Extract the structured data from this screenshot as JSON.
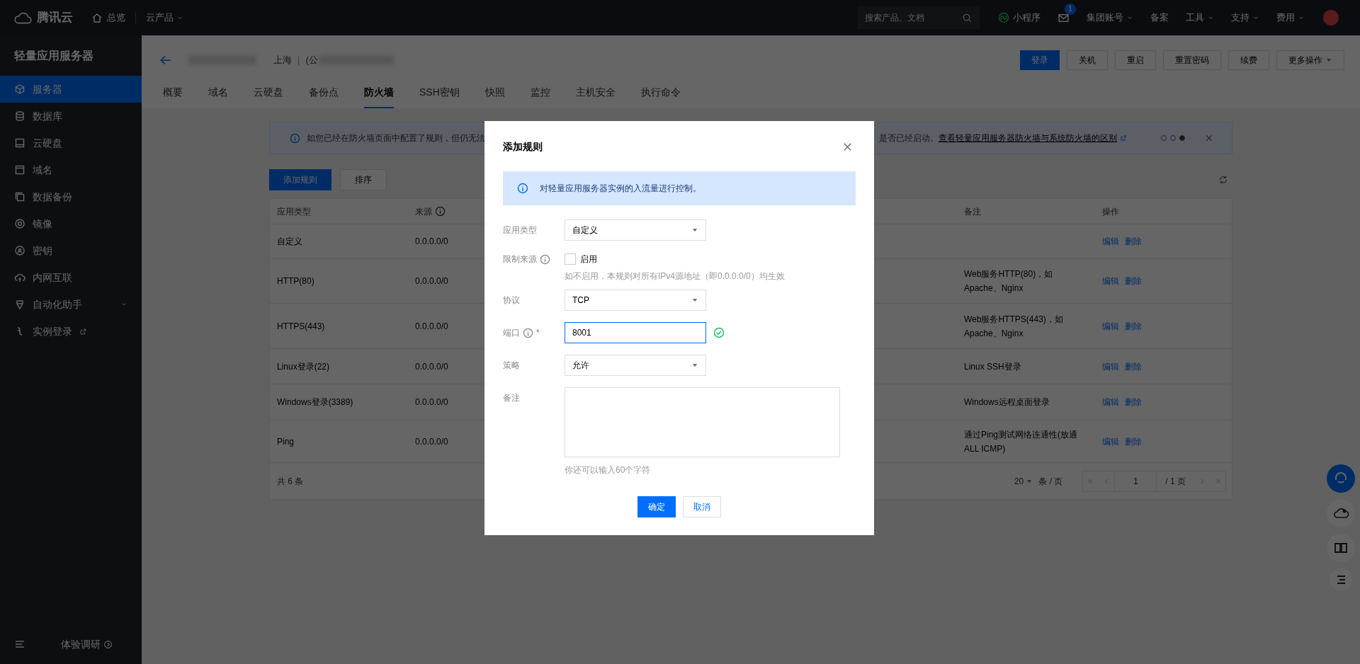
{
  "topbar": {
    "brand": "腾讯云",
    "overview": "总览",
    "products": "云产品",
    "search_placeholder": "搜索产品、文档",
    "items": [
      {
        "kind": "mini",
        "label": "小程序"
      },
      {
        "kind": "mail",
        "badge": "1"
      },
      {
        "kind": "dropdown",
        "label": "集团账号"
      },
      {
        "kind": "link",
        "label": "备案"
      },
      {
        "kind": "dropdown",
        "label": "工具"
      },
      {
        "kind": "dropdown",
        "label": "支持"
      },
      {
        "kind": "dropdown",
        "label": "费用"
      }
    ]
  },
  "sidebar": {
    "title": "轻量应用服务器",
    "items": [
      {
        "label": "服务器",
        "selected": true
      },
      {
        "label": "数据库",
        "selected": false
      },
      {
        "label": "云硬盘",
        "selected": false
      },
      {
        "label": "域名",
        "selected": false
      },
      {
        "label": "数据备份",
        "selected": false
      },
      {
        "label": "镜像",
        "selected": false
      },
      {
        "label": "密钥",
        "selected": false
      },
      {
        "label": "内网互联",
        "selected": false
      },
      {
        "label": "自动化助手",
        "selected": false,
        "expandable": true
      },
      {
        "label": "实例登录",
        "selected": false,
        "external": true
      }
    ],
    "survey": "体验调研"
  },
  "header": {
    "region": "上海",
    "separator": "|",
    "instance": "(公",
    "actions": [
      {
        "label": "登录",
        "primary": true
      },
      {
        "label": "关机",
        "primary": false
      },
      {
        "label": "重启",
        "primary": false
      },
      {
        "label": "重置密码",
        "primary": false
      },
      {
        "label": "续费",
        "primary": false
      },
      {
        "label": "更多操作",
        "primary": false,
        "dropdown": true
      }
    ],
    "tabs": [
      {
        "label": "概要",
        "selected": false
      },
      {
        "label": "域名",
        "selected": false
      },
      {
        "label": "云硬盘",
        "selected": false
      },
      {
        "label": "备份点",
        "selected": false
      },
      {
        "label": "防火墙",
        "selected": true
      },
      {
        "label": "SSH密钥",
        "selected": false
      },
      {
        "label": "快照",
        "selected": false
      },
      {
        "label": "监控",
        "selected": false
      },
      {
        "label": "主机安全",
        "selected": false
      },
      {
        "label": "执行命令",
        "selected": false
      }
    ]
  },
  "banner": {
    "text_start": "如您已经在防火墙页面中配置了规则，但仍无法",
    "text_end": "是否已经启动。",
    "link": "查看轻量应用服务器防火墙与系统防火墙的区别",
    "dots": [
      {
        "selected": false
      },
      {
        "selected": false
      },
      {
        "selected": true
      }
    ]
  },
  "toolbar": {
    "buttons": [
      {
        "label": "添加规则",
        "primary": true
      },
      {
        "label": "排序",
        "primary": false
      }
    ]
  },
  "table": {
    "columns": [
      {
        "label": "应用类型"
      },
      {
        "label": "来源",
        "info": true
      },
      {
        "label": "备注"
      },
      {
        "label": "操作"
      }
    ],
    "rows": [
      {
        "type": "自定义",
        "source": "0.0.0.0/0",
        "actions": [
          "编辑",
          "删除"
        ]
      },
      {
        "type": "HTTP(80)",
        "source": "0.0.0.0/0",
        "note": "Web服务HTTP(80)，如Apache、Nginx",
        "actions": [
          "编辑",
          "删除"
        ]
      },
      {
        "type": "HTTPS(443)",
        "source": "0.0.0.0/0",
        "note": "Web服务HTTPS(443)，如Apache、Nginx",
        "actions": [
          "编辑",
          "删除"
        ]
      },
      {
        "type": "Linux登录(22)",
        "source": "0.0.0.0/0",
        "note": "Linux SSH登录",
        "actions": [
          "编辑",
          "删除"
        ]
      },
      {
        "type": "Windows登录(3389)",
        "source": "0.0.0.0/0",
        "note": "Windows远程桌面登录",
        "actions": [
          "编辑",
          "删除"
        ]
      },
      {
        "type": "Ping",
        "source": "0.0.0.0/0",
        "note": "通过Ping测试网络连通性(放通ALL ICMP)",
        "actions": [
          "编辑",
          "删除"
        ]
      }
    ],
    "footer": {
      "total": "共 6 条",
      "page_size": "20",
      "page_size_unit": "条 / 页",
      "page": "1",
      "total_pages": "/ 1 页"
    }
  },
  "dialog": {
    "title": "添加规则",
    "info": "对轻量应用服务器实例的入流量进行控制。",
    "fields": [
      {
        "kind": "select",
        "label": "应用类型",
        "value": "自定义"
      },
      {
        "kind": "checkbox",
        "label": "限制来源",
        "info": true,
        "option": "启用",
        "checked": false,
        "hint": "如不启用，本规则对所有IPv4源地址（即0.0.0.0/0）均生效"
      },
      {
        "kind": "select",
        "label": "协议",
        "value": "TCP"
      },
      {
        "kind": "input",
        "label": "端口",
        "info": true,
        "required_mark": "*",
        "value": "8001",
        "focused": true,
        "valid": true
      },
      {
        "kind": "select",
        "label": "策略",
        "value": "允许"
      },
      {
        "kind": "textarea",
        "label": "备注",
        "hint": "你还可以输入60个字符"
      }
    ],
    "buttons": [
      {
        "label": "确定",
        "primary": true
      },
      {
        "label": "取消",
        "primary": false
      }
    ]
  }
}
